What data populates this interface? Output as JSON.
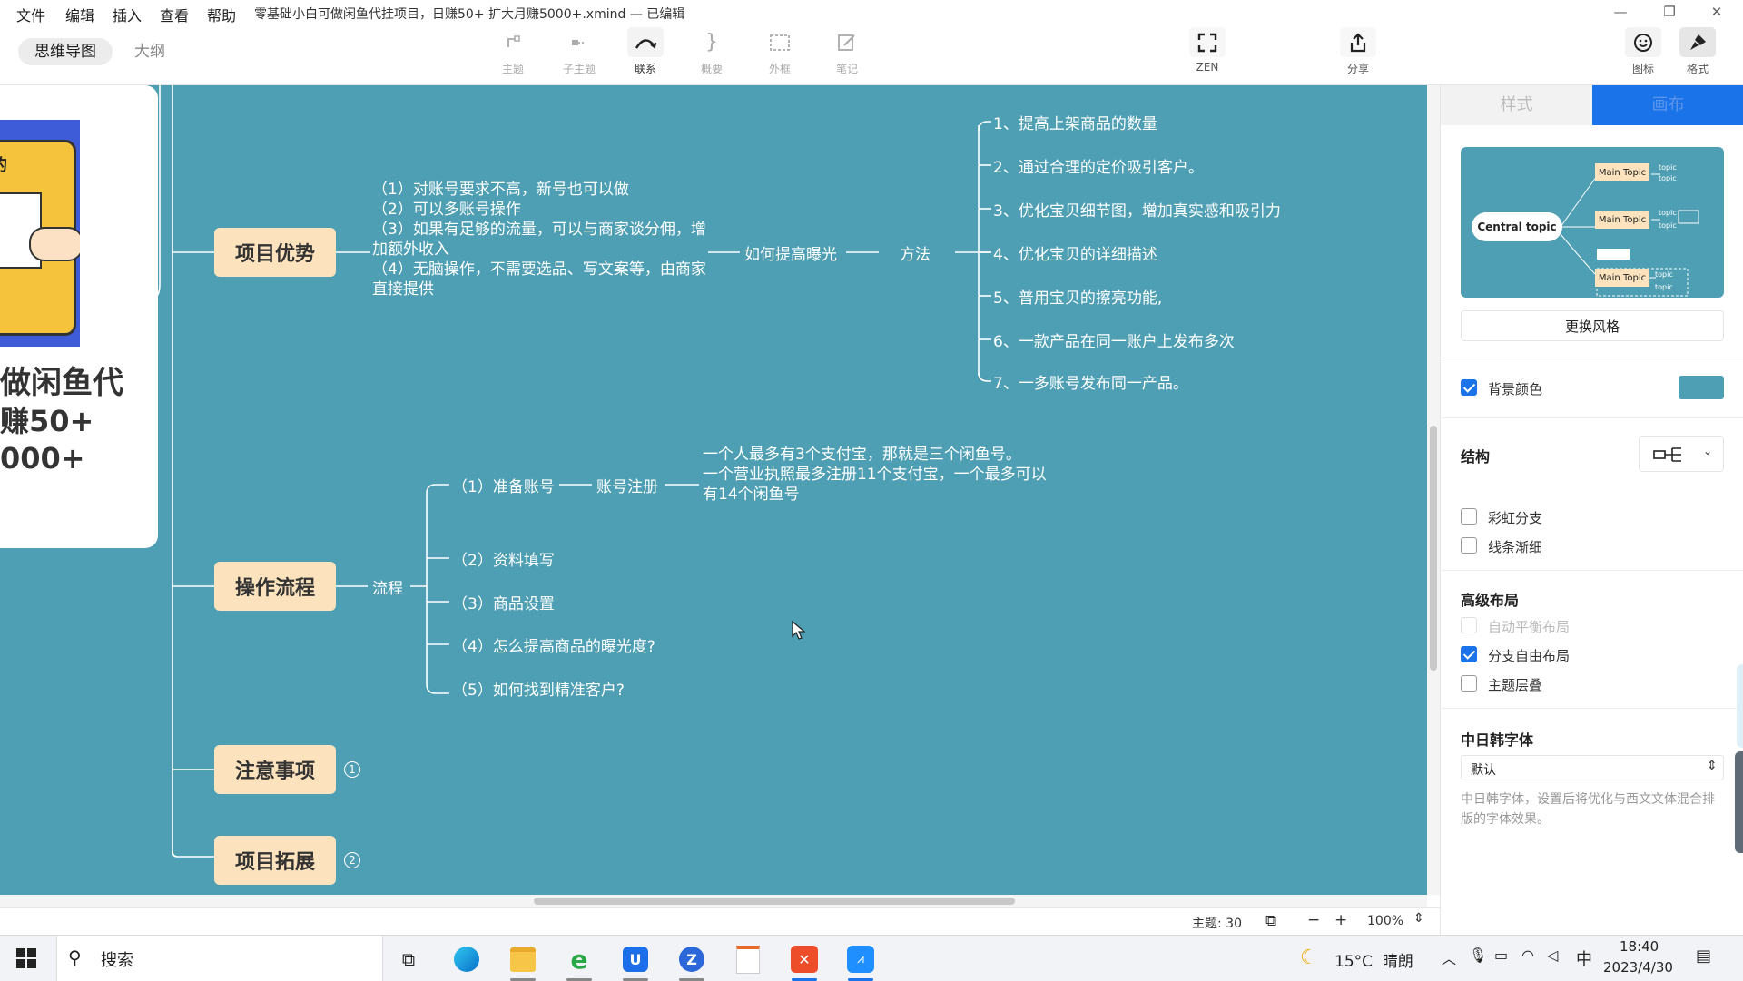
{
  "menubar": {
    "items": [
      "文件",
      "编辑",
      "插入",
      "查看",
      "帮助"
    ],
    "doc_title": "零基础小白可做闲鱼代挂项目，日赚50+ 扩大月赚5000+.xmind — 已编辑",
    "window_controls": [
      "minimize-icon",
      "restore-icon",
      "close-icon"
    ]
  },
  "toolbar": {
    "view_tabs": [
      "思维导图",
      "大纲"
    ],
    "tools": [
      {
        "label": "主题",
        "icon": "topic-icon",
        "active": false
      },
      {
        "label": "子主题",
        "icon": "subtopic-icon",
        "active": false
      },
      {
        "label": "联系",
        "icon": "relationship-icon",
        "active": true
      },
      {
        "label": "概要",
        "icon": "summary-icon",
        "active": false
      },
      {
        "label": "外框",
        "icon": "boundary-icon",
        "active": false
      },
      {
        "label": "笔记",
        "icon": "note-icon",
        "active": false
      }
    ],
    "zen_label": "ZEN",
    "share_label": "分享",
    "icons_label": "图标",
    "format_label": "格式"
  },
  "poster": {
    "lines": [
      "做闲鱼代",
      "赚50+",
      "000+"
    ],
    "sign_text": "的"
  },
  "mindmap": {
    "branch1": {
      "title": "项目优势",
      "advantages": "（1）对账号要求不高，新号也可以做\n（2）可以多账号操作\n（3）如果有足够的流量，可以与商家谈分佣，增加额外收入\n（4）无脑操作，不需要选品、写文案等，由商家直接提供",
      "node_exposure": "如何提高曝光",
      "node_method": "方法",
      "methods": [
        "1、提高上架商品的数量",
        "2、通过合理的定价吸引客户。",
        "3、优化宝贝细节图，增加真实感和吸引力",
        "4、优化宝贝的详细描述",
        "5、普用宝贝的擦亮功能,",
        "6、一款产品在同一账户上发布多次",
        "7、一多账号发布同一产品。"
      ]
    },
    "branch2": {
      "title": "操作流程",
      "node_flow": "流程",
      "steps": [
        "（1）准备账号",
        "（2）资料填写",
        "（3）商品设置",
        "（4）怎么提高商品的曝光度?",
        "（5）如何找到精准客户?"
      ],
      "node_register": "账号注册",
      "register_note": "一个人最多有3个支付宝，那就是三个闲鱼号。\n一个营业执照最多注册11个支付宝，一个最多可以有14个闲鱼号"
    },
    "branch3": {
      "title": "注意事项",
      "badge": "1"
    },
    "branch4": {
      "title": "项目拓展",
      "badge": "2"
    }
  },
  "statusbar": {
    "topic_count": "主题: 30",
    "zoom": "100%"
  },
  "panel": {
    "tabs": [
      "样式",
      "画布"
    ],
    "preview": {
      "central": "Central topic",
      "main": "Main Topic",
      "sub": "topic"
    },
    "change_style": "更换风格",
    "bg_color_label": "背景颜色",
    "bg_color": "#4e9fb4",
    "structure_label": "结构",
    "rainbow_label": "彩虹分支",
    "taper_label": "线条渐细",
    "advanced_label": "高级布局",
    "auto_balance_label": "自动平衡布局",
    "free_layout_label": "分支自由布局",
    "overlap_label": "主题层叠",
    "cjk_label": "中日韩字体",
    "cjk_value": "默认",
    "cjk_desc": "中日韩字体，设置后将优化与西文文体混合排版的字体效果。"
  },
  "taskbar": {
    "search_label": "搜索",
    "weather": "15°C  晴朗",
    "ime": "中",
    "time": "18:40",
    "date": "2023/4/30"
  },
  "colors": {
    "canvas_bg": "#4e9fb4",
    "topic_fill": "#fde3bd",
    "accent": "#1a73e8"
  }
}
